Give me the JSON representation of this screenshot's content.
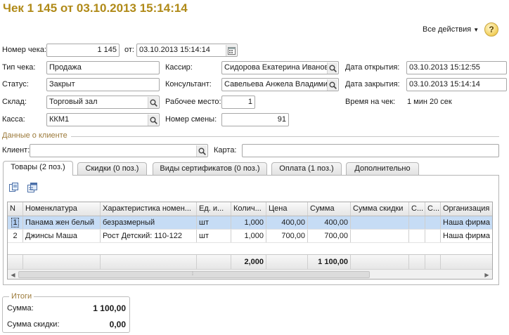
{
  "title": "Чек 1 145 от 03.10.2013 15:14:14",
  "toolbar": {
    "all_actions": "Все действия",
    "help": "?"
  },
  "header": {
    "receipt_no_label": "Номер чека:",
    "receipt_no": "1 145",
    "from_label": "от:",
    "from_value": "03.10.2013 15:14:14",
    "type_label": "Тип чека:",
    "type_value": "Продажа",
    "status_label": "Статус:",
    "status_value": "Закрыт",
    "warehouse_label": "Склад:",
    "warehouse_value": "Торговый зал",
    "register_label": "Касса:",
    "register_value": "ККМ1",
    "cashier_label": "Кассир:",
    "cashier_value": "Сидорова Екатерина Иванов",
    "consultant_label": "Консультант:",
    "consultant_value": "Савельева Анжела Владими",
    "workplace_label": "Рабочее место:",
    "workplace_value": "1",
    "shift_label": "Номер смены:",
    "shift_value": "91",
    "open_date_label": "Дата открытия:",
    "open_date_value": "03.10.2013 15:12:55",
    "close_date_label": "Дата закрытия:",
    "close_date_value": "03.10.2013 15:14:14",
    "time_label": "Время на чек:",
    "time_value": "1 мин 20 сек"
  },
  "client": {
    "section_title": "Данные о клиенте",
    "client_label": "Клиент:",
    "client_value": "",
    "card_label": "Карта:",
    "card_value": ""
  },
  "tabs": [
    {
      "label": "Товары (2 поз.)",
      "active": true
    },
    {
      "label": "Скидки (0 поз.)"
    },
    {
      "label": "Виды сертификатов (0 поз.)"
    },
    {
      "label": "Оплата (1 поз.)"
    },
    {
      "label": "Дополнительно"
    }
  ],
  "table": {
    "columns": [
      "N",
      "Номенклатура",
      "Характеристика номен...",
      "Ед. и...",
      "Колич...",
      "Цена",
      "Сумма",
      "Сумма скидки",
      "С...",
      "С...",
      "Организация"
    ],
    "rows": [
      [
        "1",
        "Панама жен белый",
        "безразмерный",
        "шт",
        "1,000",
        "400,00",
        "400,00",
        "",
        "",
        "",
        "Наша фирма"
      ],
      [
        "2",
        "Джинсы Маша",
        "Рост Детский: 110-122",
        "шт",
        "1,000",
        "700,00",
        "700,00",
        "",
        "",
        "",
        "Наша фирма"
      ]
    ],
    "footer": {
      "quantity_total": "2,000",
      "sum_total": "1 100,00"
    }
  },
  "totals": {
    "title": "Итоги",
    "sum_label": "Сумма:",
    "sum_value": "1 100,00",
    "discount_label": "Сумма скидки:",
    "discount_value": "0,00"
  },
  "colors": {
    "title": "#b08a18",
    "selection": "#c6dcf5",
    "section": "#9c7a3a"
  }
}
